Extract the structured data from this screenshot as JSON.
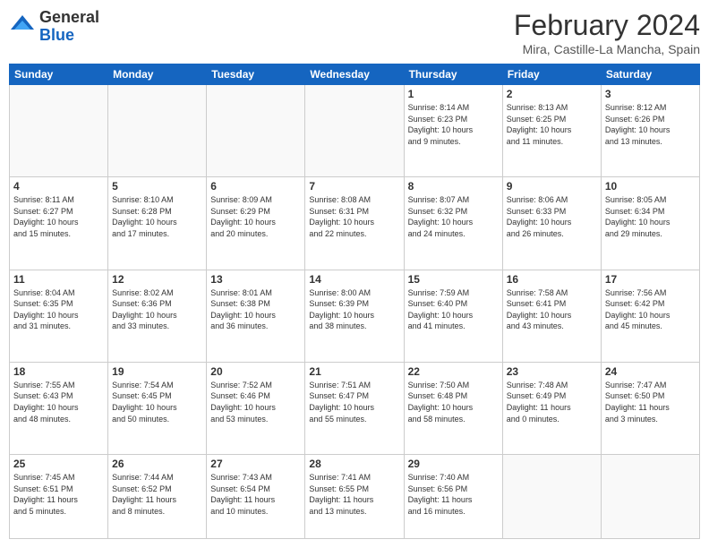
{
  "header": {
    "logo_general": "General",
    "logo_blue": "Blue",
    "month_title": "February 2024",
    "location": "Mira, Castille-La Mancha, Spain"
  },
  "weekdays": [
    "Sunday",
    "Monday",
    "Tuesday",
    "Wednesday",
    "Thursday",
    "Friday",
    "Saturday"
  ],
  "weeks": [
    [
      {
        "day": "",
        "info": ""
      },
      {
        "day": "",
        "info": ""
      },
      {
        "day": "",
        "info": ""
      },
      {
        "day": "",
        "info": ""
      },
      {
        "day": "1",
        "info": "Sunrise: 8:14 AM\nSunset: 6:23 PM\nDaylight: 10 hours\nand 9 minutes."
      },
      {
        "day": "2",
        "info": "Sunrise: 8:13 AM\nSunset: 6:25 PM\nDaylight: 10 hours\nand 11 minutes."
      },
      {
        "day": "3",
        "info": "Sunrise: 8:12 AM\nSunset: 6:26 PM\nDaylight: 10 hours\nand 13 minutes."
      }
    ],
    [
      {
        "day": "4",
        "info": "Sunrise: 8:11 AM\nSunset: 6:27 PM\nDaylight: 10 hours\nand 15 minutes."
      },
      {
        "day": "5",
        "info": "Sunrise: 8:10 AM\nSunset: 6:28 PM\nDaylight: 10 hours\nand 17 minutes."
      },
      {
        "day": "6",
        "info": "Sunrise: 8:09 AM\nSunset: 6:29 PM\nDaylight: 10 hours\nand 20 minutes."
      },
      {
        "day": "7",
        "info": "Sunrise: 8:08 AM\nSunset: 6:31 PM\nDaylight: 10 hours\nand 22 minutes."
      },
      {
        "day": "8",
        "info": "Sunrise: 8:07 AM\nSunset: 6:32 PM\nDaylight: 10 hours\nand 24 minutes."
      },
      {
        "day": "9",
        "info": "Sunrise: 8:06 AM\nSunset: 6:33 PM\nDaylight: 10 hours\nand 26 minutes."
      },
      {
        "day": "10",
        "info": "Sunrise: 8:05 AM\nSunset: 6:34 PM\nDaylight: 10 hours\nand 29 minutes."
      }
    ],
    [
      {
        "day": "11",
        "info": "Sunrise: 8:04 AM\nSunset: 6:35 PM\nDaylight: 10 hours\nand 31 minutes."
      },
      {
        "day": "12",
        "info": "Sunrise: 8:02 AM\nSunset: 6:36 PM\nDaylight: 10 hours\nand 33 minutes."
      },
      {
        "day": "13",
        "info": "Sunrise: 8:01 AM\nSunset: 6:38 PM\nDaylight: 10 hours\nand 36 minutes."
      },
      {
        "day": "14",
        "info": "Sunrise: 8:00 AM\nSunset: 6:39 PM\nDaylight: 10 hours\nand 38 minutes."
      },
      {
        "day": "15",
        "info": "Sunrise: 7:59 AM\nSunset: 6:40 PM\nDaylight: 10 hours\nand 41 minutes."
      },
      {
        "day": "16",
        "info": "Sunrise: 7:58 AM\nSunset: 6:41 PM\nDaylight: 10 hours\nand 43 minutes."
      },
      {
        "day": "17",
        "info": "Sunrise: 7:56 AM\nSunset: 6:42 PM\nDaylight: 10 hours\nand 45 minutes."
      }
    ],
    [
      {
        "day": "18",
        "info": "Sunrise: 7:55 AM\nSunset: 6:43 PM\nDaylight: 10 hours\nand 48 minutes."
      },
      {
        "day": "19",
        "info": "Sunrise: 7:54 AM\nSunset: 6:45 PM\nDaylight: 10 hours\nand 50 minutes."
      },
      {
        "day": "20",
        "info": "Sunrise: 7:52 AM\nSunset: 6:46 PM\nDaylight: 10 hours\nand 53 minutes."
      },
      {
        "day": "21",
        "info": "Sunrise: 7:51 AM\nSunset: 6:47 PM\nDaylight: 10 hours\nand 55 minutes."
      },
      {
        "day": "22",
        "info": "Sunrise: 7:50 AM\nSunset: 6:48 PM\nDaylight: 10 hours\nand 58 minutes."
      },
      {
        "day": "23",
        "info": "Sunrise: 7:48 AM\nSunset: 6:49 PM\nDaylight: 11 hours\nand 0 minutes."
      },
      {
        "day": "24",
        "info": "Sunrise: 7:47 AM\nSunset: 6:50 PM\nDaylight: 11 hours\nand 3 minutes."
      }
    ],
    [
      {
        "day": "25",
        "info": "Sunrise: 7:45 AM\nSunset: 6:51 PM\nDaylight: 11 hours\nand 5 minutes."
      },
      {
        "day": "26",
        "info": "Sunrise: 7:44 AM\nSunset: 6:52 PM\nDaylight: 11 hours\nand 8 minutes."
      },
      {
        "day": "27",
        "info": "Sunrise: 7:43 AM\nSunset: 6:54 PM\nDaylight: 11 hours\nand 10 minutes."
      },
      {
        "day": "28",
        "info": "Sunrise: 7:41 AM\nSunset: 6:55 PM\nDaylight: 11 hours\nand 13 minutes."
      },
      {
        "day": "29",
        "info": "Sunrise: 7:40 AM\nSunset: 6:56 PM\nDaylight: 11 hours\nand 16 minutes."
      },
      {
        "day": "",
        "info": ""
      },
      {
        "day": "",
        "info": ""
      }
    ]
  ]
}
